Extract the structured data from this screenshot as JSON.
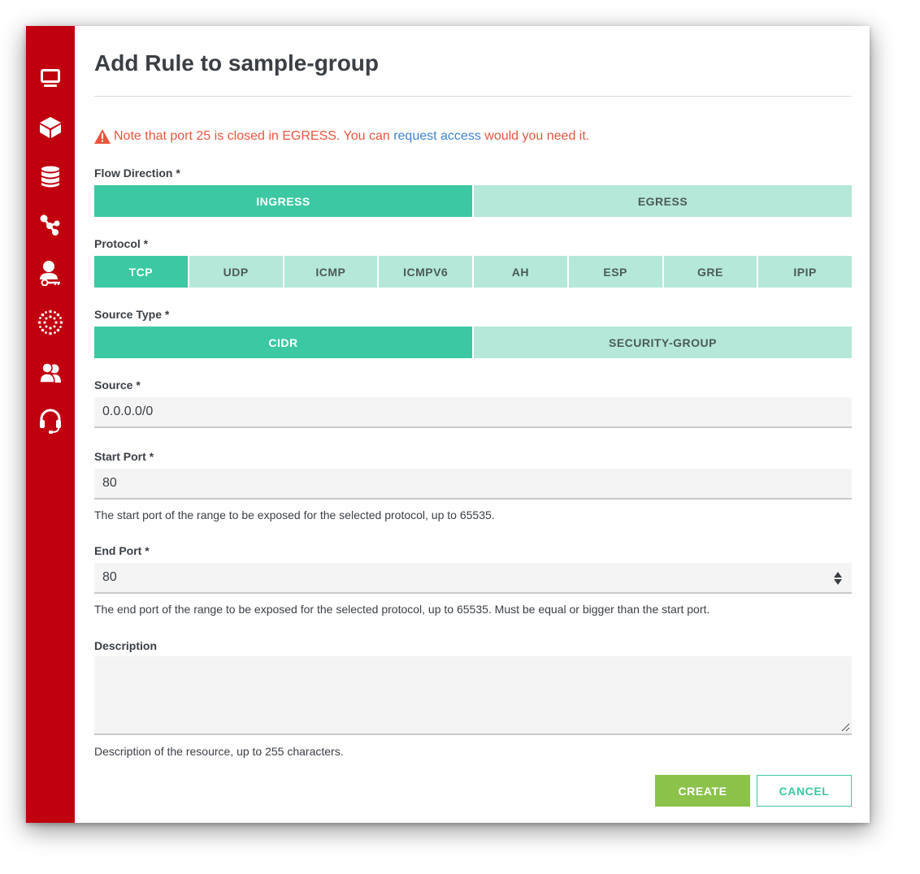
{
  "sidebar": {
    "items": [
      {
        "icon": "monitor-icon"
      },
      {
        "icon": "cube-icon"
      },
      {
        "icon": "database-icon"
      },
      {
        "icon": "network-icon"
      },
      {
        "icon": "user-key-icon"
      },
      {
        "icon": "cluster-icon"
      },
      {
        "icon": "users-icon"
      },
      {
        "icon": "headset-icon"
      }
    ]
  },
  "dialog": {
    "title": "Add Rule to sample-group",
    "notice": {
      "prefix": "Note that port 25 is closed in EGRESS. You can ",
      "link": "request access",
      "suffix": " would you need it."
    },
    "flow_direction": {
      "label": "Flow Direction *",
      "options": [
        "INGRESS",
        "EGRESS"
      ],
      "selected": "INGRESS"
    },
    "protocol": {
      "label": "Protocol *",
      "options": [
        "TCP",
        "UDP",
        "ICMP",
        "ICMPV6",
        "AH",
        "ESP",
        "GRE",
        "IPIP"
      ],
      "selected": "TCP"
    },
    "source_type": {
      "label": "Source Type *",
      "options": [
        "CIDR",
        "SECURITY-GROUP"
      ],
      "selected": "CIDR"
    },
    "source": {
      "label": "Source *",
      "value": "0.0.0.0/0"
    },
    "start_port": {
      "label": "Start Port *",
      "value": "80",
      "help": "The start port of the range to be exposed for the selected protocol, up to 65535."
    },
    "end_port": {
      "label": "End Port *",
      "value": "80",
      "help": "The end port of the range to be exposed for the selected protocol, up to 65535. Must be equal or bigger than the start port."
    },
    "description": {
      "label": "Description",
      "value": "",
      "help": "Description of the resource, up to 255 characters."
    },
    "buttons": {
      "create": "CREATE",
      "cancel": "CANCEL"
    }
  },
  "colors": {
    "sidebar": "#c0000f",
    "active_segment": "#3cc8a3",
    "inactive_segment": "#b5e8d9",
    "create_button": "#8bc34a",
    "warning": "#e9563f",
    "link": "#3c84d2"
  }
}
